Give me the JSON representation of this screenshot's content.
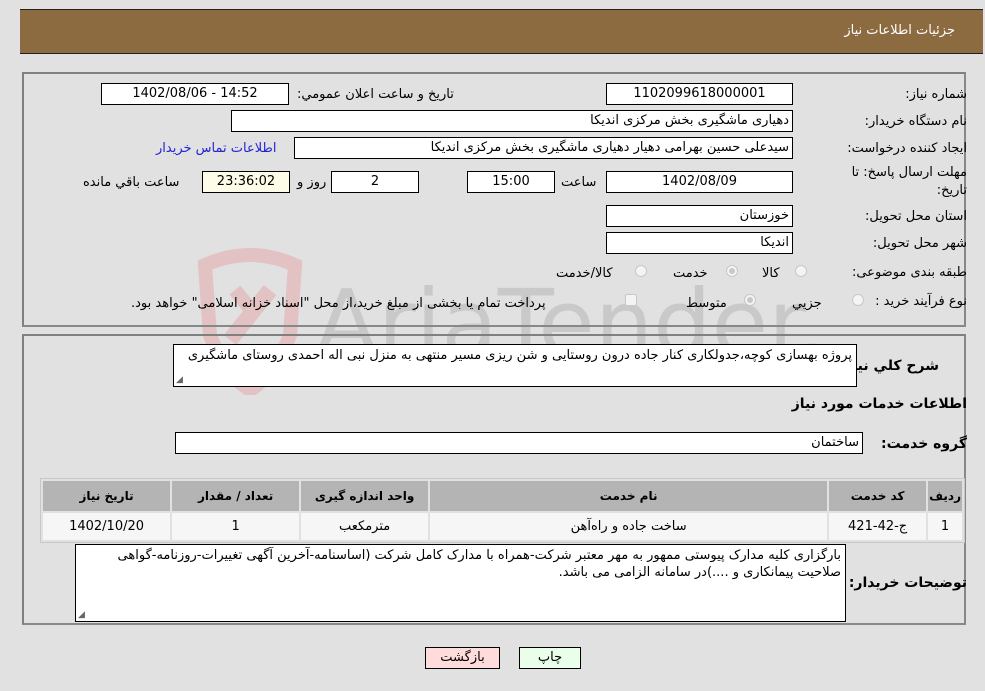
{
  "header": {
    "title": "جزئيات اطلاعات نياز"
  },
  "form": {
    "need_number": {
      "label": "شماره نياز:",
      "value": "1102099618000001"
    },
    "announce_datetime": {
      "label": "تاريخ و ساعت اعلان عمومي:",
      "value": "1402/08/06 - 14:52"
    },
    "buyer_org": {
      "label": "نام دستگاه خريدار:",
      "value": "دهیاری ماشگیری بخش مرکزی اندیکا"
    },
    "requester": {
      "label": "ايجاد كننده درخواست:",
      "value": "سیدعلی حسین بهرامی دهیار دهیاری ماشگیری بخش مرکزی اندیکا"
    },
    "buyer_contact_link": "اطلاعات تماس خريدار",
    "deadline": {
      "label": "مهلت ارسال پاسخ: تا تاريخ:",
      "date": "1402/08/09",
      "time_label": "ساعت",
      "time": "15:00",
      "days": "2",
      "days_label": "روز و",
      "remaining": "23:36:02",
      "remaining_label": "ساعت باقي مانده"
    },
    "province": {
      "label": "استان محل تحويل:",
      "value": "خوزستان"
    },
    "city": {
      "label": "شهر محل تحويل:",
      "value": "اندیکا"
    },
    "category": {
      "label": "طبقه بندی موضوعی:",
      "options": [
        "کالا",
        "خدمت",
        "کالا/خدمت"
      ],
      "selected": "خدمت"
    },
    "purchase_type": {
      "label": "نوع فرآيند خريد :",
      "options": [
        "جزيي",
        "متوسط"
      ],
      "selected": "متوسط",
      "treasury_note": "پرداخت تمام يا بخشی از مبلغ خريد،از محل \"اسناد خزانه اسلامی\" خواهد بود."
    }
  },
  "description": {
    "label": "شرح كلي نياز:",
    "value": "پروژه بهسازی کوچه،جدولکاری کنار جاده درون روستایی و شن ریزی مسیر منتهی به منزل نبی اله احمدی روستای ماشگیری"
  },
  "services_section": {
    "title": "اطلاعات خدمات مورد نياز",
    "group_label": "گروه خدمت:",
    "group_value": "ساختمان"
  },
  "table": {
    "headers": [
      "رديف",
      "کد خدمت",
      "نام خدمت",
      "واحد اندازه گیری",
      "تعداد / مقدار",
      "تاريخ نياز"
    ],
    "rows": [
      [
        "1",
        "ج-42-421",
        "ساخت جاده و راه‌آهن",
        "مترمکعب",
        "1",
        "1402/10/20"
      ]
    ]
  },
  "buyer_notes": {
    "label": "توضيحات خريدار:",
    "value": "بارگزاری کلیه مدارک پیوستی ممهور به مهر معتبر شرکت-همراه با مدارک کامل شرکت (اساسنامه-آخرین آگهی تغییرات-روزنامه-گواهی صلاحیت پیمانکاری و ....)در سامانه الزامی می باشد."
  },
  "buttons": {
    "print": "چاپ",
    "back": "بازگشت"
  },
  "watermark": {
    "text": "AriaTender.neT"
  }
}
